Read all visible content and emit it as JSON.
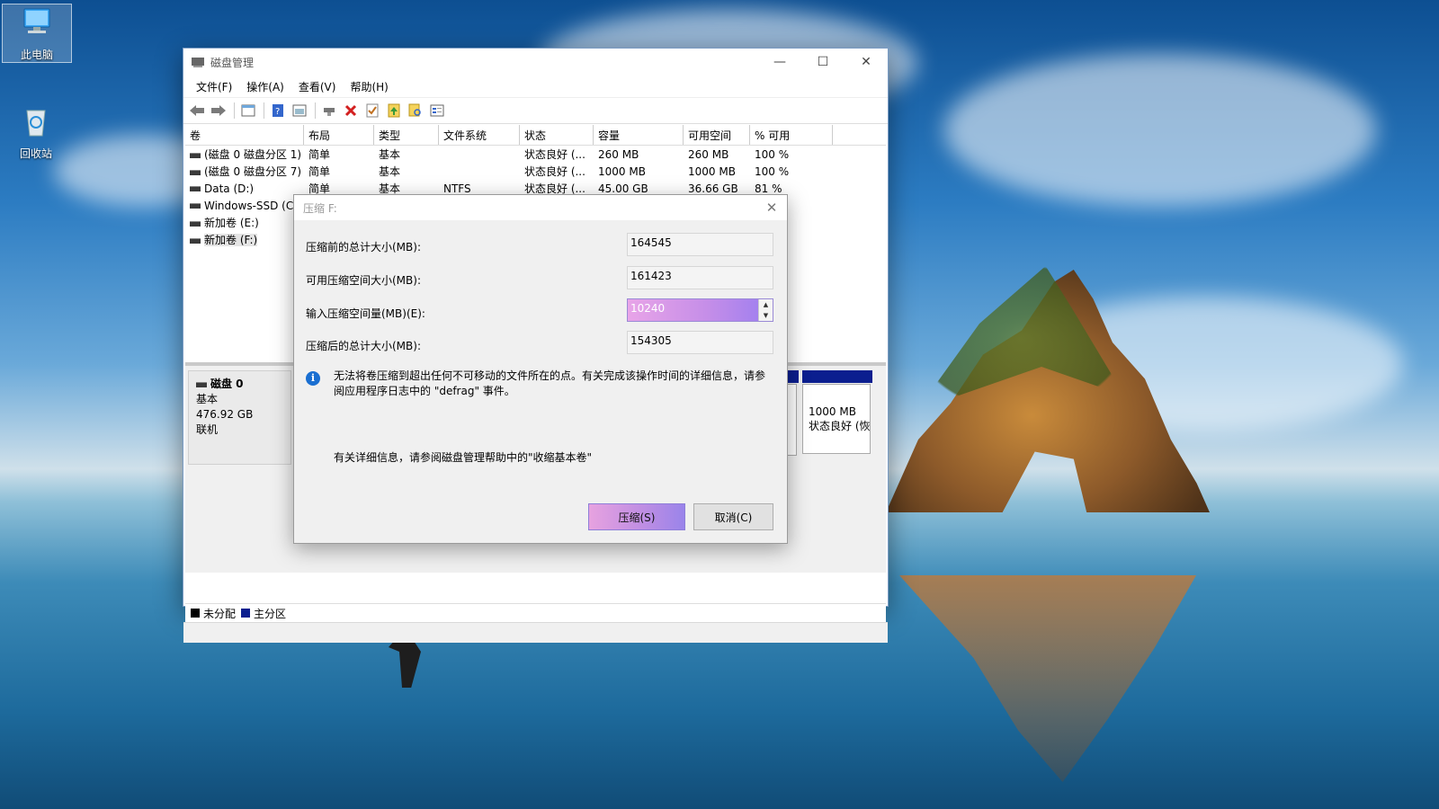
{
  "desktop": {
    "icons": [
      {
        "label": "此电脑",
        "icon": "computer-icon"
      },
      {
        "label": "回收站",
        "icon": "recycle-bin-icon"
      }
    ]
  },
  "window": {
    "title": "磁盘管理",
    "menu": [
      "文件(F)",
      "操作(A)",
      "查看(V)",
      "帮助(H)"
    ],
    "toolbar_icons": [
      "back-icon",
      "forward-icon",
      "console-tree-icon",
      "help-icon",
      "properties-icon",
      "connect-icon",
      "delete-icon",
      "check-icon",
      "up-icon",
      "search-icon",
      "settings-icon"
    ],
    "columns": [
      "卷",
      "布局",
      "类型",
      "文件系统",
      "状态",
      "容量",
      "可用空间",
      "% 可用"
    ],
    "volumes": [
      {
        "name": "(磁盘 0 磁盘分区 1)",
        "layout": "简单",
        "type": "基本",
        "fs": "",
        "status": "状态良好 (...",
        "capacity": "260 MB",
        "free": "260 MB",
        "pct": "100 %"
      },
      {
        "name": "(磁盘 0 磁盘分区 7)",
        "layout": "简单",
        "type": "基本",
        "fs": "",
        "status": "状态良好 (...",
        "capacity": "1000 MB",
        "free": "1000 MB",
        "pct": "100 %"
      },
      {
        "name": "Data (D:)",
        "layout": "简单",
        "type": "基本",
        "fs": "NTFS",
        "status": "状态良好 (...",
        "capacity": "45.00 GB",
        "free": "36.66 GB",
        "pct": "81 %"
      },
      {
        "name": "Windows-SSD (C",
        "layout": "",
        "type": "",
        "fs": "",
        "status": "",
        "capacity": "",
        "free": "",
        "pct": ""
      },
      {
        "name": "新加卷 (E:)",
        "layout": "",
        "type": "",
        "fs": "",
        "status": "",
        "capacity": "",
        "free": "",
        "pct": ""
      },
      {
        "name": "新加卷 (F:)",
        "layout": "",
        "type": "",
        "fs": "",
        "status": "",
        "capacity": "",
        "free": "",
        "pct": ""
      }
    ],
    "disk": {
      "name": "磁盘 0",
      "kind": "基本",
      "size": "476.92 GB",
      "state": "联机",
      "partition_size": "1000 MB",
      "partition_status": "状态良好 (恢"
    },
    "legend": [
      {
        "label": "未分配",
        "color": "#000000"
      },
      {
        "label": "主分区",
        "color": "#0b1e8f"
      }
    ]
  },
  "dialog": {
    "title": "压缩 F:",
    "fields": [
      {
        "label": "压缩前的总计大小(MB):",
        "value": "164545"
      },
      {
        "label": "可用压缩空间大小(MB):",
        "value": "161423"
      },
      {
        "label": "输入压缩空间量(MB)(E):",
        "value": "10240"
      },
      {
        "label": "压缩后的总计大小(MB):",
        "value": "154305"
      }
    ],
    "info": "无法将卷压缩到超出任何不可移动的文件所在的点。有关完成该操作时间的详细信息，请参阅应用程序日志中的 \"defrag\" 事件。",
    "more_info": "有关详细信息，请参阅磁盘管理帮助中的\"收缩基本卷\"",
    "ok_label": "压缩(S)",
    "cancel_label": "取消(C)"
  }
}
